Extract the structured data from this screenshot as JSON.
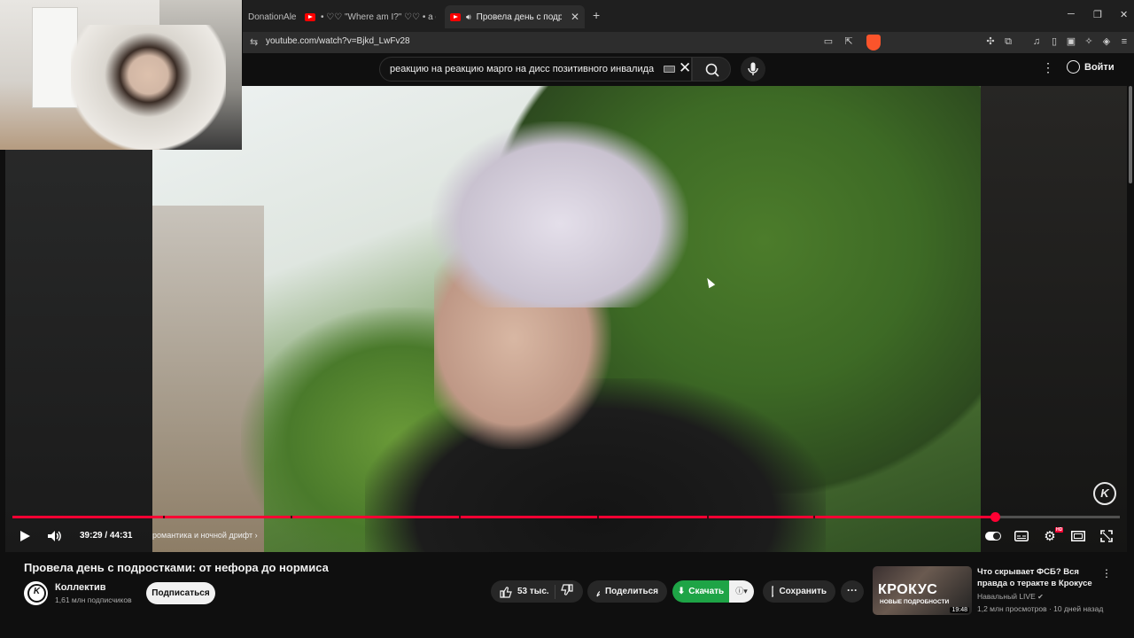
{
  "browser": {
    "tabs": [
      {
        "label": "DonationAlerts"
      },
      {
        "label": "• ♡♡ \"Where am I?\" ♡♡ • a dreamcore"
      },
      {
        "label": "Провела день с подростками",
        "active": true
      }
    ],
    "url": "youtube.com/watch?v=Bjkd_LwFv28"
  },
  "youtube": {
    "search_query": "реакцию на реакцию марго на дисс позитивного инвалида",
    "signin_label": "Войти"
  },
  "player": {
    "time_display": "39:29 / 44:31",
    "chapter_label": "романтика и ночной дрифт",
    "chapter_chevron": "›",
    "watermark": "K",
    "progress_fraction": 0.887
  },
  "video": {
    "title": "Провела день с подростками: от нефора до нормиса",
    "channel_name": "Коллектив",
    "subscribers": "1,61 млн подписчиков",
    "subscribe_label": "Подписаться",
    "likes": "53 тыс.",
    "share_label": "Поделиться",
    "download_label": "Скачать",
    "save_label": "Сохранить"
  },
  "recommendation": {
    "title": "Что скрывает ФСБ? Вся правда о теракте в Крокусе",
    "channel": "Навальный LIVE",
    "meta": "1,2 млн просмотров · 10 дней назад",
    "thumb_title": "КРОКУС",
    "thumb_subtitle": "НОВЫЕ ПОДРОБНОСТИ",
    "duration": "19:48"
  },
  "colors": {
    "accent": "#ff0033",
    "download": "#1ea446",
    "background": "#0f0f0f"
  }
}
